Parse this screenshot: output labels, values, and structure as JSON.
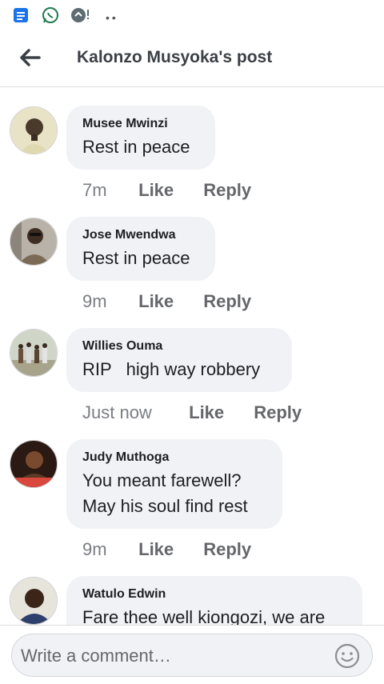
{
  "header": {
    "title": "Kalonzo Musyoka's post"
  },
  "comments": [
    {
      "author": "Musee Mwinzi",
      "text_lines": [
        "Rest in peace"
      ],
      "time": "7m",
      "like": "Like",
      "reply": "Reply"
    },
    {
      "author": "Jose Mwendwa",
      "text_lines": [
        "Rest in peace"
      ],
      "time": "9m",
      "like": "Like",
      "reply": "Reply"
    },
    {
      "author": "Willies Ouma",
      "text_lines": [
        "RIP   high way robbery"
      ],
      "time": "Just now",
      "like": "Like",
      "reply": "Reply"
    },
    {
      "author": "Judy Muthoga",
      "text_lines": [
        "You meant farewell?",
        "May his soul find rest"
      ],
      "time": "9m",
      "like": "Like",
      "reply": "Reply"
    },
    {
      "author": "Watulo Edwin",
      "text_lines": [
        "Fare thee well kiongozi, we are"
      ]
    }
  ],
  "composer": {
    "placeholder": "Write a comment…"
  },
  "icons": {
    "status": [
      "docs-icon",
      "whatsapp-icon",
      "app-notification-icon"
    ],
    "back": "back-arrow-icon",
    "emoji": "emoji-icon"
  },
  "colors": {
    "bubble": "#f0f2f5",
    "header_text": "#3b3f46",
    "action_text": "#65676b",
    "whatsapp": "#25d366",
    "docs": "#1a73e8"
  }
}
